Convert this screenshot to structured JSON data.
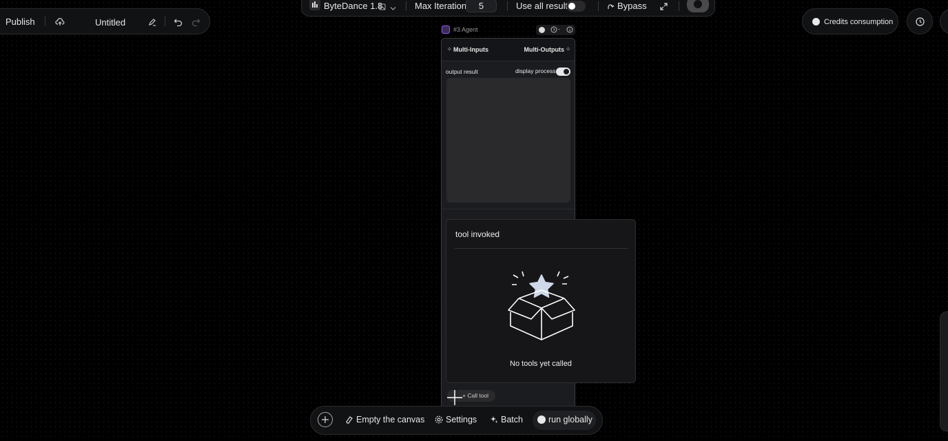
{
  "left_toolbar": {
    "publish_label": "Publish",
    "document_title": "Untitled"
  },
  "top_toolbar": {
    "model_label": "ByteDance 1.8",
    "max_iteration_label": "Max Iteration",
    "max_iteration_value": "5",
    "use_all_results_label": "Use all results",
    "use_all_results_on": false,
    "bypass_label": "Bypass"
  },
  "right_controls": {
    "credits_label": "Credits consumption"
  },
  "agent_node": {
    "label": "#3 Agent",
    "multi_inputs": "Multi-Inputs",
    "multi_outputs": "Multi-Outputs",
    "output_result_label": "output result",
    "display_process_label": "display process",
    "display_process_on": true,
    "call_tool_label": "+ Call tool"
  },
  "tool_popup": {
    "title": "tool invoked",
    "empty_text": "No tools yet called"
  },
  "bottom_toolbar": {
    "empty_canvas": "Empty the canvas",
    "settings": "Settings",
    "batch": "Batch",
    "run_globally": "run globally"
  },
  "icons": {
    "upload": "cloud-upload-icon",
    "edit": "pencil-icon",
    "undo": "undo-icon",
    "redo": "redo-icon",
    "expand": "expand-icon",
    "history": "clock-icon"
  },
  "colors": {
    "background": "#000000",
    "panel": "#111214",
    "node": "#1b1c1f",
    "accent_purple": "#9b5cf6"
  }
}
